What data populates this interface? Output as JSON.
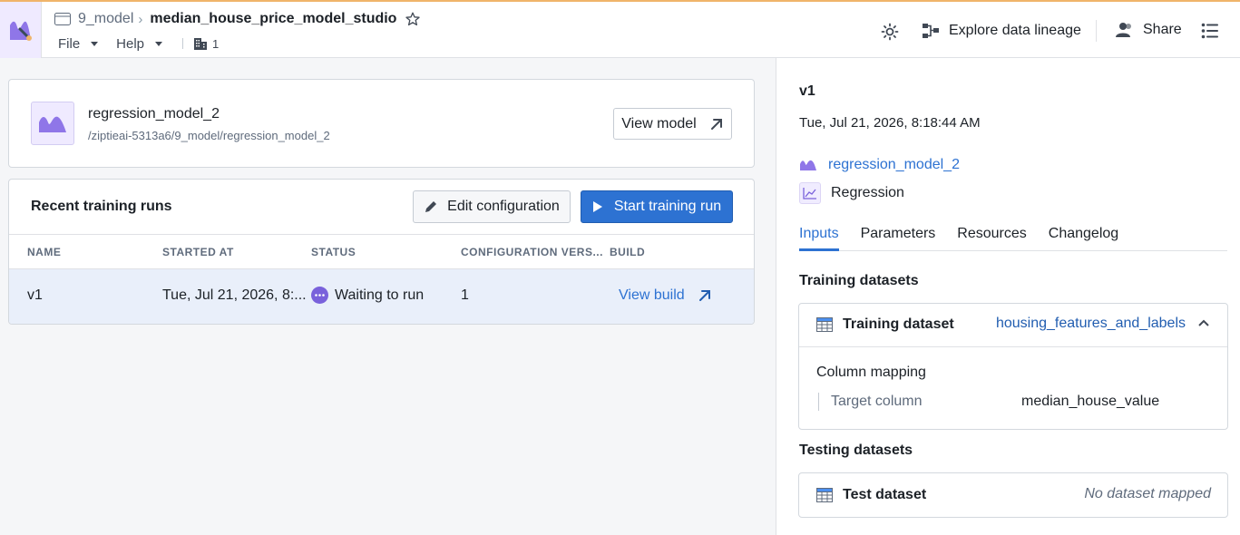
{
  "header": {
    "folder": "9_model",
    "title": "median_house_price_model_studio",
    "menus": [
      "File",
      "Help"
    ],
    "build_count": "1",
    "actions": {
      "lineage_label": "Explore data lineage",
      "share_label": "Share"
    }
  },
  "model_card": {
    "name": "regression_model_2",
    "path": "/ziptieai-5313a6/9_model/regression_model_2",
    "view_label": "View model"
  },
  "runs": {
    "title": "Recent training runs",
    "edit_label": "Edit configuration",
    "start_label": "Start training run",
    "columns": [
      "NAME",
      "STARTED AT",
      "STATUS",
      "CONFIGURATION VERS...",
      "BUILD"
    ],
    "rows": [
      {
        "name": "v1",
        "started_at": "Tue, Jul 21, 2026, 8:...",
        "status": "Waiting to run",
        "config_version": "1",
        "build": "View build"
      }
    ]
  },
  "detail": {
    "version": "v1",
    "date": "Tue, Jul 21, 2026, 8:18:44 AM",
    "model_link": "regression_model_2",
    "model_type": "Regression",
    "tabs": [
      "Inputs",
      "Parameters",
      "Resources",
      "Changelog"
    ],
    "active_tab": "Inputs",
    "training_title": "Training datasets",
    "training": {
      "name": "Training dataset",
      "dataset": "housing_features_and_labels",
      "mapping_label": "Column mapping",
      "target_label": "Target column",
      "target_value": "median_house_value"
    },
    "testing_title": "Testing datasets",
    "testing": {
      "name": "Test dataset",
      "empty": "No dataset mapped"
    }
  },
  "colors": {
    "accent": "#2d72d2",
    "purple": "#7961db",
    "row_selected": "#e9effa"
  }
}
